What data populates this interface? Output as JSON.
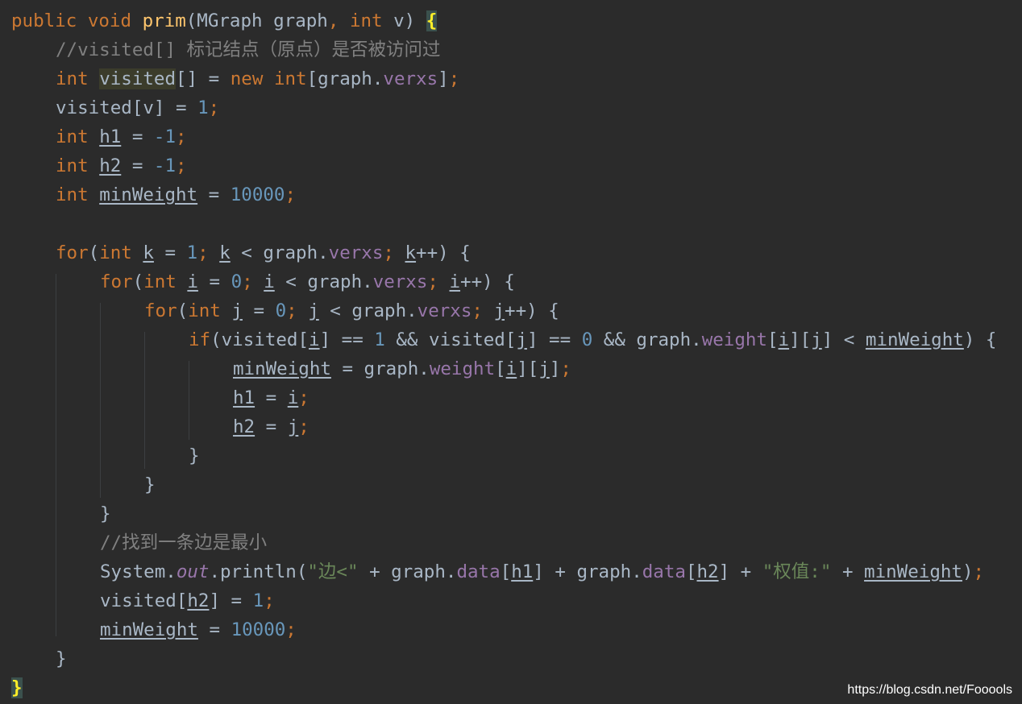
{
  "code": {
    "lines": [
      {
        "indent": 0,
        "tokens": [
          {
            "t": "public ",
            "c": "kw"
          },
          {
            "t": "void ",
            "c": "kw"
          },
          {
            "t": "prim",
            "c": "fn"
          },
          {
            "t": "(MGraph graph",
            "c": "plain"
          },
          {
            "t": ", ",
            "c": "kw"
          },
          {
            "t": "int ",
            "c": "kw"
          },
          {
            "t": "v) ",
            "c": "plain"
          },
          {
            "t": "{",
            "c": "brace-hl"
          }
        ]
      },
      {
        "indent": 1,
        "tokens": [
          {
            "t": "//visited[] 标记结点（原点）是否被访问过",
            "c": "cmt"
          }
        ]
      },
      {
        "indent": 1,
        "tokens": [
          {
            "t": "int ",
            "c": "kw"
          },
          {
            "t": "visited",
            "c": "hl"
          },
          {
            "t": "[] = ",
            "c": "plain"
          },
          {
            "t": "new ",
            "c": "kw"
          },
          {
            "t": "int",
            "c": "kw"
          },
          {
            "t": "[graph.",
            "c": "plain"
          },
          {
            "t": "verxs",
            "c": "fld"
          },
          {
            "t": "]",
            "c": "plain"
          },
          {
            "t": ";",
            "c": "kw"
          }
        ]
      },
      {
        "indent": 1,
        "tokens": [
          {
            "t": "visited[v] = ",
            "c": "plain"
          },
          {
            "t": "1",
            "c": "num"
          },
          {
            "t": ";",
            "c": "kw"
          }
        ]
      },
      {
        "indent": 1,
        "tokens": [
          {
            "t": "int ",
            "c": "kw"
          },
          {
            "t": "h1",
            "c": "ul"
          },
          {
            "t": " = ",
            "c": "plain"
          },
          {
            "t": "-1",
            "c": "num"
          },
          {
            "t": ";",
            "c": "kw"
          }
        ]
      },
      {
        "indent": 1,
        "tokens": [
          {
            "t": "int ",
            "c": "kw"
          },
          {
            "t": "h2",
            "c": "ul"
          },
          {
            "t": " = ",
            "c": "plain"
          },
          {
            "t": "-1",
            "c": "num"
          },
          {
            "t": ";",
            "c": "kw"
          }
        ]
      },
      {
        "indent": 1,
        "tokens": [
          {
            "t": "int ",
            "c": "kw"
          },
          {
            "t": "minWeight",
            "c": "ul"
          },
          {
            "t": " = ",
            "c": "plain"
          },
          {
            "t": "10000",
            "c": "num"
          },
          {
            "t": ";",
            "c": "kw"
          }
        ]
      },
      {
        "indent": 0,
        "tokens": []
      },
      {
        "indent": 1,
        "tokens": [
          {
            "t": "for",
            "c": "kw"
          },
          {
            "t": "(",
            "c": "plain"
          },
          {
            "t": "int ",
            "c": "kw"
          },
          {
            "t": "k",
            "c": "ul"
          },
          {
            "t": " = ",
            "c": "plain"
          },
          {
            "t": "1",
            "c": "num"
          },
          {
            "t": "; ",
            "c": "kw"
          },
          {
            "t": "k",
            "c": "ul"
          },
          {
            "t": " < graph.",
            "c": "plain"
          },
          {
            "t": "verxs",
            "c": "fld"
          },
          {
            "t": "; ",
            "c": "kw"
          },
          {
            "t": "k",
            "c": "ul"
          },
          {
            "t": "++) {",
            "c": "plain"
          }
        ]
      },
      {
        "indent": 2,
        "tokens": [
          {
            "t": "for",
            "c": "kw"
          },
          {
            "t": "(",
            "c": "plain"
          },
          {
            "t": "int ",
            "c": "kw"
          },
          {
            "t": "i",
            "c": "ul"
          },
          {
            "t": " = ",
            "c": "plain"
          },
          {
            "t": "0",
            "c": "num"
          },
          {
            "t": "; ",
            "c": "kw"
          },
          {
            "t": "i",
            "c": "ul"
          },
          {
            "t": " < graph.",
            "c": "plain"
          },
          {
            "t": "verxs",
            "c": "fld"
          },
          {
            "t": "; ",
            "c": "kw"
          },
          {
            "t": "i",
            "c": "ul"
          },
          {
            "t": "++) {",
            "c": "plain"
          }
        ]
      },
      {
        "indent": 3,
        "tokens": [
          {
            "t": "for",
            "c": "kw"
          },
          {
            "t": "(",
            "c": "plain"
          },
          {
            "t": "int ",
            "c": "kw"
          },
          {
            "t": "j",
            "c": "ul"
          },
          {
            "t": " = ",
            "c": "plain"
          },
          {
            "t": "0",
            "c": "num"
          },
          {
            "t": "; ",
            "c": "kw"
          },
          {
            "t": "j",
            "c": "ul"
          },
          {
            "t": " < graph.",
            "c": "plain"
          },
          {
            "t": "verxs",
            "c": "fld"
          },
          {
            "t": "; ",
            "c": "kw"
          },
          {
            "t": "j",
            "c": "ul"
          },
          {
            "t": "++) {",
            "c": "plain"
          }
        ]
      },
      {
        "indent": 4,
        "tokens": [
          {
            "t": "if",
            "c": "kw"
          },
          {
            "t": "(visited[",
            "c": "plain"
          },
          {
            "t": "i",
            "c": "ul"
          },
          {
            "t": "] == ",
            "c": "plain"
          },
          {
            "t": "1 ",
            "c": "num"
          },
          {
            "t": "&& visited[",
            "c": "plain"
          },
          {
            "t": "j",
            "c": "ul"
          },
          {
            "t": "] == ",
            "c": "plain"
          },
          {
            "t": "0 ",
            "c": "num"
          },
          {
            "t": "&& graph.",
            "c": "plain"
          },
          {
            "t": "weight",
            "c": "fld"
          },
          {
            "t": "[",
            "c": "plain"
          },
          {
            "t": "i",
            "c": "ul"
          },
          {
            "t": "][",
            "c": "plain"
          },
          {
            "t": "j",
            "c": "ul"
          },
          {
            "t": "] < ",
            "c": "plain"
          },
          {
            "t": "minWeight",
            "c": "ul"
          },
          {
            "t": ") {",
            "c": "plain"
          }
        ]
      },
      {
        "indent": 5,
        "tokens": [
          {
            "t": "minWeight",
            "c": "ul"
          },
          {
            "t": " = graph.",
            "c": "plain"
          },
          {
            "t": "weight",
            "c": "fld"
          },
          {
            "t": "[",
            "c": "plain"
          },
          {
            "t": "i",
            "c": "ul"
          },
          {
            "t": "][",
            "c": "plain"
          },
          {
            "t": "j",
            "c": "ul"
          },
          {
            "t": "]",
            "c": "plain"
          },
          {
            "t": ";",
            "c": "kw"
          }
        ]
      },
      {
        "indent": 5,
        "tokens": [
          {
            "t": "h1",
            "c": "ul"
          },
          {
            "t": " = ",
            "c": "plain"
          },
          {
            "t": "i",
            "c": "ul"
          },
          {
            "t": ";",
            "c": "kw"
          }
        ]
      },
      {
        "indent": 5,
        "tokens": [
          {
            "t": "h2",
            "c": "ul"
          },
          {
            "t": " = ",
            "c": "plain"
          },
          {
            "t": "j",
            "c": "ul"
          },
          {
            "t": ";",
            "c": "kw"
          }
        ]
      },
      {
        "indent": 4,
        "tokens": [
          {
            "t": "}",
            "c": "plain"
          }
        ]
      },
      {
        "indent": 3,
        "tokens": [
          {
            "t": "}",
            "c": "plain"
          }
        ]
      },
      {
        "indent": 2,
        "tokens": [
          {
            "t": "}",
            "c": "plain"
          }
        ]
      },
      {
        "indent": 2,
        "tokens": [
          {
            "t": "//找到一条边是最小",
            "c": "cmt"
          }
        ]
      },
      {
        "indent": 2,
        "tokens": [
          {
            "t": "System.",
            "c": "plain"
          },
          {
            "t": "out",
            "c": "fld ital"
          },
          {
            "t": ".println(",
            "c": "plain"
          },
          {
            "t": "\"边<\"",
            "c": "str"
          },
          {
            "t": " + graph.",
            "c": "plain"
          },
          {
            "t": "data",
            "c": "fld"
          },
          {
            "t": "[",
            "c": "plain"
          },
          {
            "t": "h1",
            "c": "ul"
          },
          {
            "t": "] + graph.",
            "c": "plain"
          },
          {
            "t": "data",
            "c": "fld"
          },
          {
            "t": "[",
            "c": "plain"
          },
          {
            "t": "h2",
            "c": "ul"
          },
          {
            "t": "] + ",
            "c": "plain"
          },
          {
            "t": "\"权值:\"",
            "c": "str"
          },
          {
            "t": " + ",
            "c": "plain"
          },
          {
            "t": "minWeight",
            "c": "ul"
          },
          {
            "t": ")",
            "c": "plain"
          },
          {
            "t": ";",
            "c": "kw"
          }
        ]
      },
      {
        "indent": 2,
        "tokens": [
          {
            "t": "visited[",
            "c": "plain"
          },
          {
            "t": "h2",
            "c": "ul"
          },
          {
            "t": "] = ",
            "c": "plain"
          },
          {
            "t": "1",
            "c": "num"
          },
          {
            "t": ";",
            "c": "kw"
          }
        ]
      },
      {
        "indent": 2,
        "tokens": [
          {
            "t": "minWeight",
            "c": "ul"
          },
          {
            "t": " = ",
            "c": "plain"
          },
          {
            "t": "10000",
            "c": "num"
          },
          {
            "t": ";",
            "c": "kw"
          }
        ]
      },
      {
        "indent": 1,
        "tokens": [
          {
            "t": "}",
            "c": "plain"
          }
        ]
      },
      {
        "indent": 0,
        "tokens": [
          {
            "t": "}",
            "c": "brace-hl"
          }
        ]
      }
    ]
  },
  "watermark": "https://blog.csdn.net/Fooools",
  "colors": {
    "background": "#2b2b2b",
    "keyword": "#cc7832",
    "function": "#ffc66d",
    "number": "#6897bb",
    "field": "#9876aa",
    "string": "#6a8759",
    "comment": "#808080",
    "text": "#a9b7c6",
    "brace_highlight": "#ffef28"
  }
}
